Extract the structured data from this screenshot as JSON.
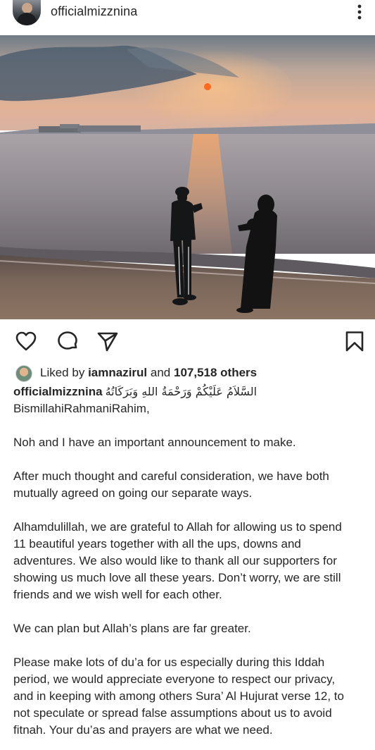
{
  "post": {
    "username": "officialmizznina",
    "icons": {
      "avatar": "profile-avatar",
      "more": "more-vertical-icon",
      "like": "heart-icon",
      "comment": "comment-icon",
      "share": "send-icon",
      "save": "bookmark-icon"
    }
  },
  "likes": {
    "prefix": "Liked by",
    "liker": "iamnazirul",
    "middle": "and",
    "count": "107,518 others"
  },
  "caption": {
    "username": "officialmizznina",
    "greeting": "السَّلاَمُ عَلَيْكُمْ وَرَحْمَةُ اللهِ وَبَرَكَاتُهُ",
    "paragraphs": [
      [
        "BismillahiRahmaniRahim,"
      ],
      [
        "Noh and I have an important announcement to make."
      ],
      [
        "After much thought and careful consideration, we have both",
        "mutually agreed on going our separate ways."
      ],
      [
        "Alhamdulillah, we are grateful to Allah for allowing us to spend",
        "11 beautiful years together with all the ups, downs and",
        "adventures. We also would like to thank all our supporters for",
        "showing us much love all these years. Don’t worry, we are still",
        "friends and we wish well for each other."
      ],
      [
        "We can plan but Allah’s plans are far greater."
      ],
      [
        "Please make lots of du’a for us especially during this Iddah",
        "period, we would appreciate everyone to respect our privacy,",
        "and in keeping with among others Sura’ Al Hujurat verse 12, to",
        "not speculate or spread false assumptions about us to avoid",
        "fitnah. Your du’as and prayers are what we need."
      ]
    ]
  }
}
